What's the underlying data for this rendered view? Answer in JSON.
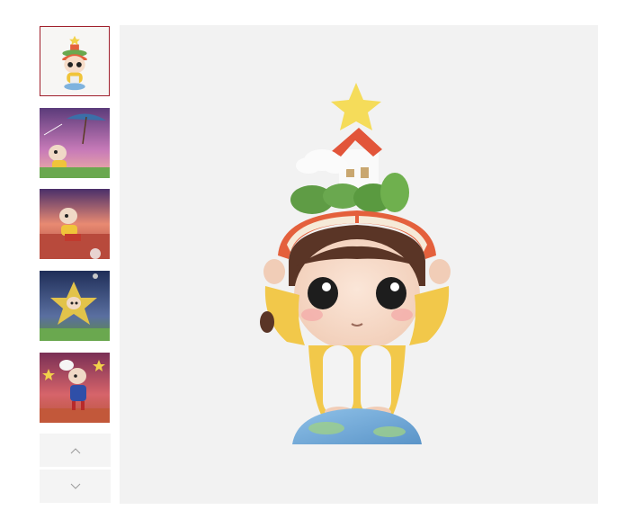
{
  "gallery": {
    "thumbnails": [
      {
        "alt": "figure-front",
        "active": true
      },
      {
        "alt": "figure-umbrella-scene",
        "active": false
      },
      {
        "alt": "figure-sunset-scene",
        "active": false
      },
      {
        "alt": "figure-starry-scene",
        "active": false
      },
      {
        "alt": "figure-stars-scene",
        "active": false
      }
    ],
    "nav": {
      "up_icon": "chevron-up-icon",
      "down_icon": "chevron-down-icon"
    },
    "colors": {
      "active_border": "#a01f2b",
      "main_bg": "#f2f2f2",
      "nav_bg": "#f4f4f4"
    }
  }
}
